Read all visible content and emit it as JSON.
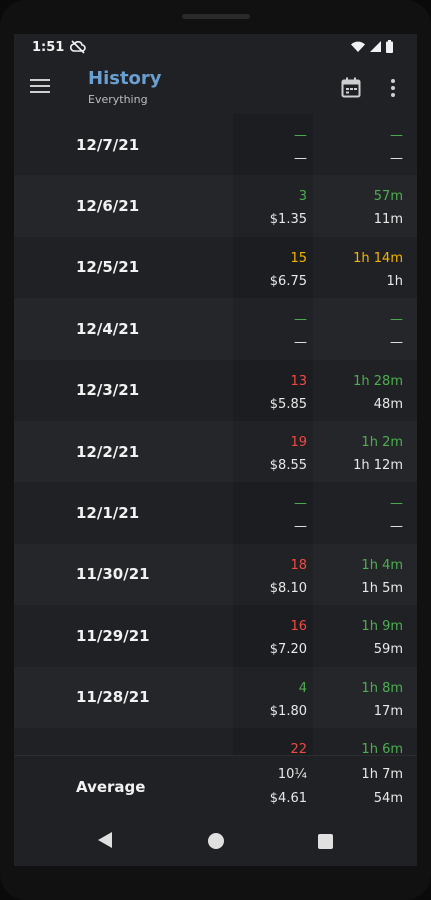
{
  "status": {
    "time": "1:51"
  },
  "appbar": {
    "title": "History",
    "subtitle": "Everything"
  },
  "rows": [
    {
      "date": "12/7/21",
      "count": "—",
      "count_color": "green",
      "cost": "—",
      "time_top": "—",
      "time_bottom": "—"
    },
    {
      "date": "12/6/21",
      "count": "3",
      "count_color": "green",
      "cost": "$1.35",
      "time_top": "57m",
      "time_bottom": "11m"
    },
    {
      "date": "12/5/21",
      "count": "15",
      "count_color": "orange",
      "cost": "$6.75",
      "time_top": "1h 14m",
      "time_bottom": "1h"
    },
    {
      "date": "12/4/21",
      "count": "—",
      "count_color": "green",
      "cost": "—",
      "time_top": "—",
      "time_bottom": "—"
    },
    {
      "date": "12/3/21",
      "count": "13",
      "count_color": "red",
      "cost": "$5.85",
      "time_top": "1h 28m",
      "time_bottom": "48m"
    },
    {
      "date": "12/2/21",
      "count": "19",
      "count_color": "red",
      "cost": "$8.55",
      "time_top": "1h 2m",
      "time_bottom": "1h 12m"
    },
    {
      "date": "12/1/21",
      "count": "—",
      "count_color": "green",
      "cost": "—",
      "time_top": "—",
      "time_bottom": "—"
    },
    {
      "date": "11/30/21",
      "count": "18",
      "count_color": "red",
      "cost": "$8.10",
      "time_top": "1h 4m",
      "time_bottom": "1h 5m"
    },
    {
      "date": "11/29/21",
      "count": "16",
      "count_color": "red",
      "cost": "$7.20",
      "time_top": "1h 9m",
      "time_bottom": "59m"
    },
    {
      "date": "11/28/21",
      "count": "4",
      "count_color": "green",
      "cost": "$1.80",
      "time_top": "1h 8m",
      "time_bottom": "17m"
    },
    {
      "date": "",
      "count": "22",
      "count_color": "red",
      "cost": "",
      "time_top": "1h 6m",
      "time_bottom": ""
    }
  ],
  "average": {
    "label": "Average",
    "count": "10¼",
    "cost": "$4.61",
    "time_top": "1h 7m",
    "time_bottom": "54m"
  },
  "colors": {
    "green": "#4caf50",
    "orange": "#f5b400",
    "red": "#f04a44",
    "title": "#6a9fd0",
    "background": "#202124"
  }
}
